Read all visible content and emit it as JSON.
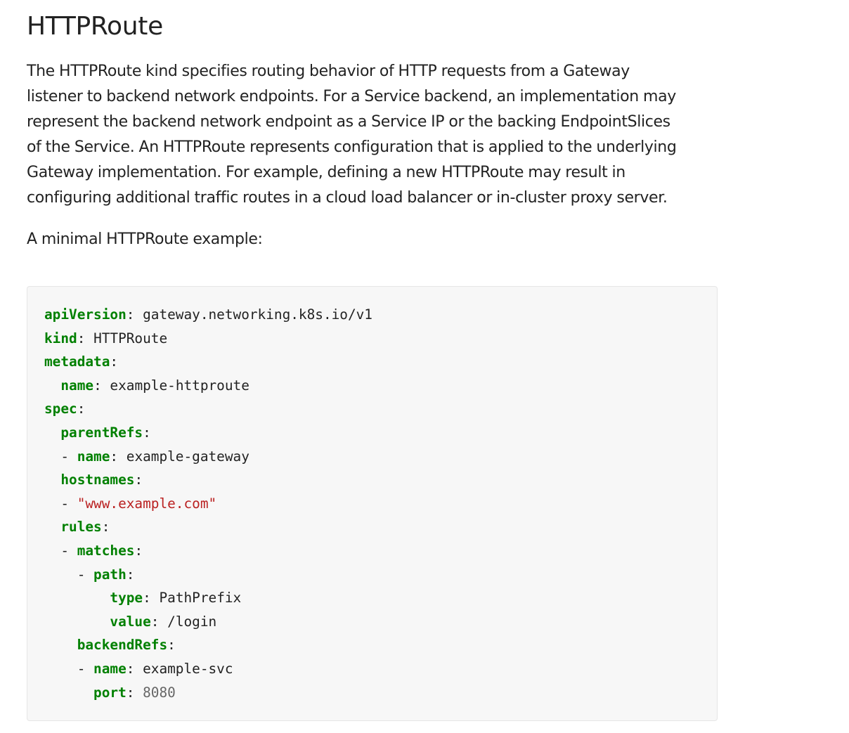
{
  "heading": "HTTPRoute",
  "intro_lines": [
    "The HTTPRoute kind specifies routing behavior of HTTP requests from a Gateway",
    "listener to backend network endpoints. For a Service backend, an implementation may",
    "represent the backend network endpoint as a Service IP or the backing EndpointSlices",
    "of the Service. An HTTPRoute represents configuration that is applied to the underlying",
    "Gateway implementation. For example, defining a new HTTPRoute may result in",
    "configuring additional traffic routes in a cloud load balancer or in-cluster proxy server."
  ],
  "example_label": "A minimal HTTPRoute example:",
  "code": {
    "language": "yaml",
    "colors": {
      "key": "#008000",
      "string": "#ba2121",
      "number": "#666666",
      "text": "#222222",
      "background": "#f7f7f7"
    },
    "lines": [
      {
        "indent": "",
        "dash": "",
        "key": "apiVersion",
        "value": "gateway.networking.k8s.io/v1",
        "value_type": "plain"
      },
      {
        "indent": "",
        "dash": "",
        "key": "kind",
        "value": "HTTPRoute",
        "value_type": "plain"
      },
      {
        "indent": "",
        "dash": "",
        "key": "metadata",
        "value": "",
        "value_type": "plain"
      },
      {
        "indent": "  ",
        "dash": "",
        "key": "name",
        "value": "example-httproute",
        "value_type": "plain"
      },
      {
        "indent": "",
        "dash": "",
        "key": "spec",
        "value": "",
        "value_type": "plain"
      },
      {
        "indent": "  ",
        "dash": "",
        "key": "parentRefs",
        "value": "",
        "value_type": "plain"
      },
      {
        "indent": "  ",
        "dash": "- ",
        "key": "name",
        "value": "example-gateway",
        "value_type": "plain"
      },
      {
        "indent": "  ",
        "dash": "",
        "key": "hostnames",
        "value": "",
        "value_type": "plain"
      },
      {
        "indent": "  ",
        "dash": "- ",
        "key": "",
        "value": "\"www.example.com\"",
        "value_type": "string"
      },
      {
        "indent": "  ",
        "dash": "",
        "key": "rules",
        "value": "",
        "value_type": "plain"
      },
      {
        "indent": "  ",
        "dash": "- ",
        "key": "matches",
        "value": "",
        "value_type": "plain"
      },
      {
        "indent": "    ",
        "dash": "- ",
        "key": "path",
        "value": "",
        "value_type": "plain"
      },
      {
        "indent": "        ",
        "dash": "",
        "key": "type",
        "value": "PathPrefix",
        "value_type": "plain"
      },
      {
        "indent": "        ",
        "dash": "",
        "key": "value",
        "value": "/login",
        "value_type": "plain"
      },
      {
        "indent": "    ",
        "dash": "",
        "key": "backendRefs",
        "value": "",
        "value_type": "plain"
      },
      {
        "indent": "    ",
        "dash": "- ",
        "key": "name",
        "value": "example-svc",
        "value_type": "plain"
      },
      {
        "indent": "      ",
        "dash": "",
        "key": "port",
        "value": "8080",
        "value_type": "number"
      }
    ]
  }
}
